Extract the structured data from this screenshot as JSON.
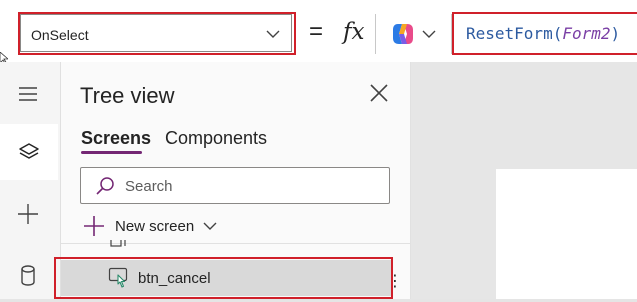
{
  "formula_bar": {
    "property": "OnSelect",
    "equals": "=",
    "fx": "fx",
    "formula": {
      "function": "ResetForm",
      "open": "(",
      "argument": "Form2",
      "close": ")"
    }
  },
  "rail": {
    "items": [
      {
        "name": "hamburger-menu",
        "icon": "hamburger-icon"
      },
      {
        "name": "tree-view",
        "icon": "layers-icon",
        "active": true
      },
      {
        "name": "insert",
        "icon": "plus-icon"
      },
      {
        "name": "data",
        "icon": "database-icon"
      }
    ]
  },
  "tree_view": {
    "title": "Tree view",
    "tabs": [
      {
        "label": "Screens",
        "active": true
      },
      {
        "label": "Components",
        "active": false
      }
    ],
    "search": {
      "placeholder": "Search",
      "value": ""
    },
    "new_screen_label": "New screen",
    "selected_item": {
      "label": "btn_cancel",
      "icon": "button-icon"
    },
    "more": "⋮"
  },
  "colors": {
    "accent": "#742774",
    "highlight_box": "#d0202a",
    "selected_row": "#d9d9d9",
    "formula_function": "#2c5aa0",
    "formula_argument": "#7a3fa5"
  }
}
